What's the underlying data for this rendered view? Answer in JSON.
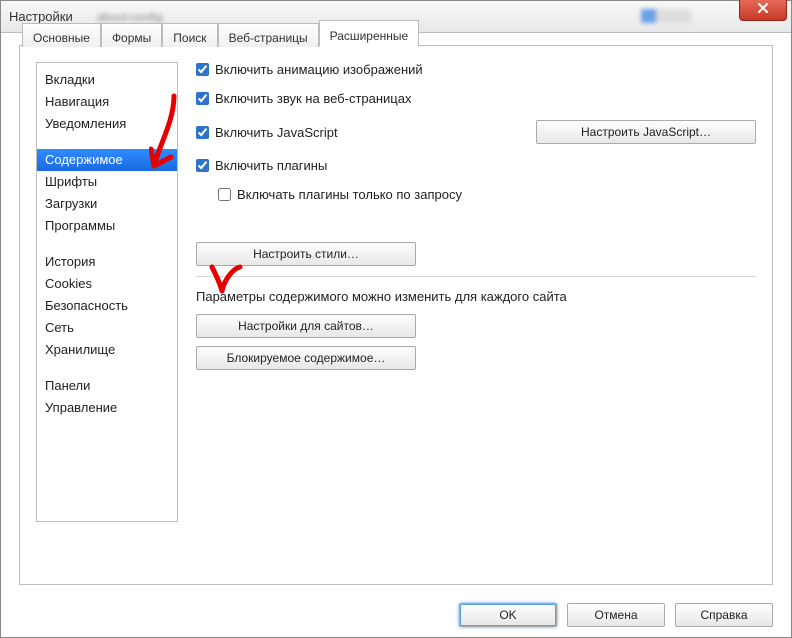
{
  "window": {
    "title": "Настройки"
  },
  "tabs": [
    {
      "label": "Основные"
    },
    {
      "label": "Формы"
    },
    {
      "label": "Поиск"
    },
    {
      "label": "Веб-страницы"
    },
    {
      "label": "Расширенные"
    }
  ],
  "sidebar": {
    "items": [
      {
        "label": "Вкладки"
      },
      {
        "label": "Навигация"
      },
      {
        "label": "Уведомления"
      },
      {
        "label": "Содержимое",
        "selected": true
      },
      {
        "label": "Шрифты"
      },
      {
        "label": "Загрузки"
      },
      {
        "label": "Программы"
      },
      {
        "label": "История"
      },
      {
        "label": "Cookies"
      },
      {
        "label": "Безопасность"
      },
      {
        "label": "Сеть"
      },
      {
        "label": "Хранилище"
      },
      {
        "label": "Панели"
      },
      {
        "label": "Управление"
      }
    ]
  },
  "content": {
    "chk_anim": "Включить анимацию изображений",
    "chk_sound": "Включить звук на веб-страницах",
    "chk_js": "Включить JavaScript",
    "btn_js": "Настроить JavaScript…",
    "chk_plugins": "Включить плагины",
    "chk_plugins_on_demand": "Включать плагины только по запросу",
    "btn_styles": "Настроить стили…",
    "per_site_text": "Параметры содержимого можно изменить для каждого сайта",
    "btn_site_prefs": "Настройки для сайтов…",
    "btn_blocked": "Блокируемое содержимое…"
  },
  "footer": {
    "ok": "OK",
    "cancel": "Отмена",
    "help": "Справка"
  }
}
